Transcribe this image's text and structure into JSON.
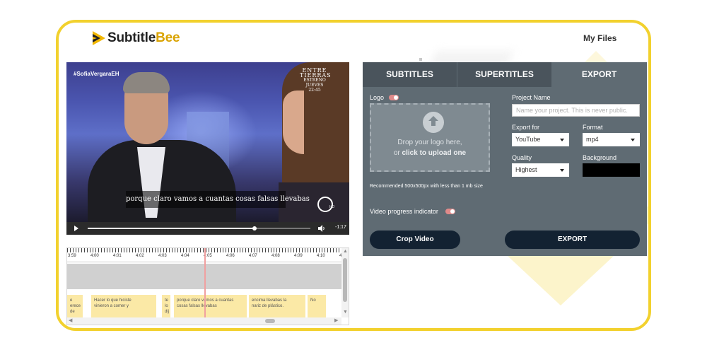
{
  "brand": {
    "name_part1": "Subtitle",
    "name_part2": "Bee",
    "accent": "#f2d12e"
  },
  "header": {
    "my_files": "My Files"
  },
  "video": {
    "hashtag": "#SofiaVergaraEH",
    "badge_title": "ENTRE TIERRAS",
    "badge_sub1": "ESTRENO",
    "badge_sub2": "JUEVES 22:45",
    "subtitle": "porque claro vamos a cuantas cosas falsas llevabas",
    "channel_hd": "HD",
    "time_remaining": "-1:17",
    "progress": 0.75
  },
  "timeline": {
    "ticks": [
      "3:59",
      "4:00",
      "4:01",
      "4:02",
      "4:03",
      "4:04",
      "4:05",
      "4:06",
      "4:07",
      "4:08",
      "4:09",
      "4:10",
      "4"
    ],
    "captions": [
      {
        "text": "e\nerece\nde"
      },
      {
        "text": "Hacer lo que hiciste\nvinieron a comer y"
      },
      {
        "text": "te\nlo\ndij"
      },
      {
        "text": "porque claro vamos a cuantas\ncosas falsas llevabas"
      },
      {
        "text": "encima llevabas la\nnariz de plástico."
      },
      {
        "text": "No"
      }
    ],
    "scroll_up": "▲",
    "scroll_down": "▼",
    "scroll_left": "◀",
    "scroll_right": "▶"
  },
  "panel": {
    "tabs": [
      "SUBTITLES",
      "SUPERTITLES",
      "EXPORT"
    ],
    "active_tab": "EXPORT",
    "logo_label": "Logo",
    "dropzone_line1": "Drop your logo here,",
    "dropzone_or": "or ",
    "dropzone_link": "click to upload one",
    "recommendation": "Recommended 500x500px with less than 1 mb size",
    "progress_indicator_label": "Video progress indicator",
    "project_name_label": "Project Name",
    "project_name_placeholder": "Name your project. This is never public.",
    "export_for_label": "Export for",
    "export_for_value": "YouTube",
    "format_label": "Format",
    "format_value": "mp4",
    "quality_label": "Quality",
    "quality_value": "Highest",
    "background_label": "Background",
    "background_color": "#000000",
    "crop_button": "Crop Video",
    "export_button": "EXPORT"
  }
}
